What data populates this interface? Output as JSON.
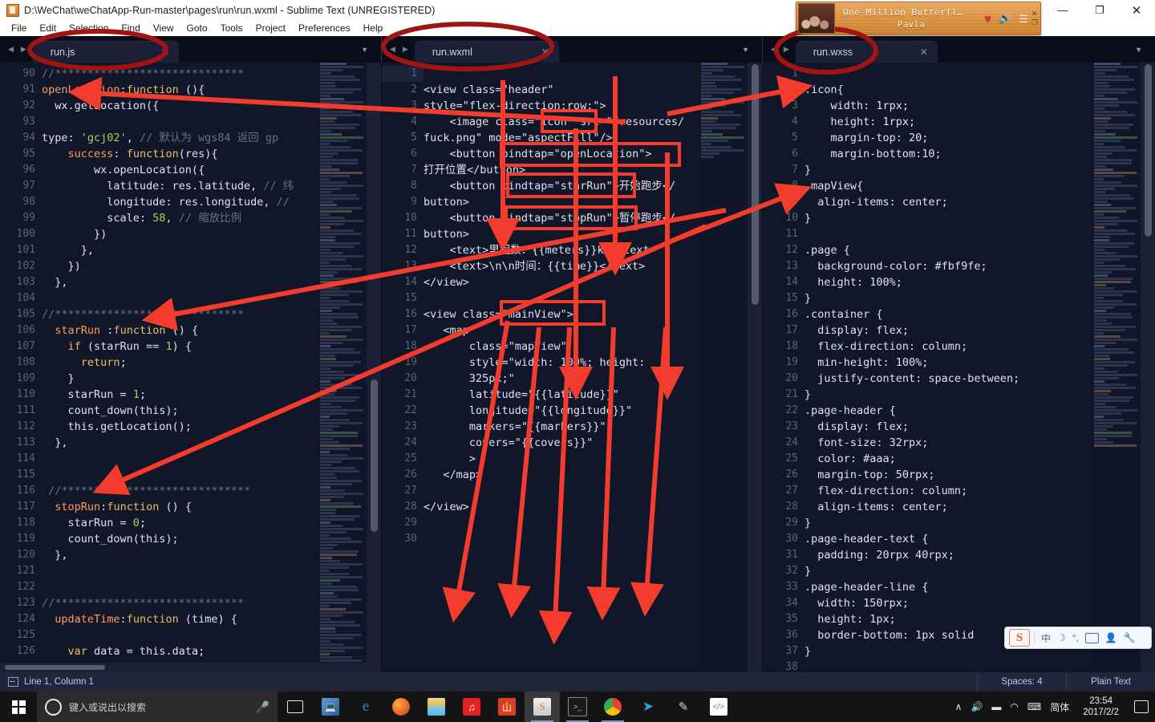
{
  "window": {
    "title": "D:\\WeChat\\weChatApp-Run-master\\pages\\run\\run.wxml - Sublime Text (UNREGISTERED)",
    "minimize": "—",
    "maximize": "❐",
    "close": "✕"
  },
  "menu": [
    "File",
    "Edit",
    "Selection",
    "Find",
    "View",
    "Goto",
    "Tools",
    "Project",
    "Preferences",
    "Help"
  ],
  "music": {
    "title": "One Million Butterfl…",
    "artist": "Pavla",
    "heart": "♥",
    "volume": "🔊",
    "playlist": "☰",
    "close": "✕",
    "restore": "❐"
  },
  "tabs": [
    {
      "name": "run.js",
      "close": "✕",
      "circled": true
    },
    {
      "name": "run.wxml",
      "close": "✕",
      "circled": true
    },
    {
      "name": "run.wxss",
      "close": "✕",
      "circled": true
    }
  ],
  "nav": {
    "prev": "◀",
    "next": "▶",
    "dropdown": "▼"
  },
  "panes": {
    "left": {
      "file": "run.js",
      "first_line": 90,
      "lines": [
        [
          {
            "t": "//*****************************",
            "c": "cm"
          }
        ],
        [
          {
            "t": "openLocation",
            "c": "k"
          },
          {
            "t": ":",
            "c": "pl"
          },
          {
            "t": "function",
            "c": "kw"
          },
          {
            "t": " (){",
            "c": "pl"
          }
        ],
        [
          {
            "t": "  wx.getLocation({",
            "c": "pl"
          }
        ],
        [
          {
            "t": "",
            "c": "pl"
          }
        ],
        [
          {
            "t": "type: ",
            "c": "pl"
          },
          {
            "t": "'gcj02'",
            "c": "str"
          },
          {
            "t": ", ",
            "c": "pl"
          },
          {
            "t": "// 默认为 wgs84 返回 gp",
            "c": "cm"
          }
        ],
        [
          {
            "t": "    ",
            "c": "pl"
          },
          {
            "t": "success",
            "c": "k"
          },
          {
            "t": ": ",
            "c": "pl"
          },
          {
            "t": "function",
            "c": "kw"
          },
          {
            "t": "(res){",
            "c": "pl"
          }
        ],
        [
          {
            "t": "        wx.openLocation({",
            "c": "pl"
          }
        ],
        [
          {
            "t": "          latitude: res.latitude, ",
            "c": "pl"
          },
          {
            "t": "// 纬",
            "c": "cm"
          }
        ],
        [
          {
            "t": "          longitude: res.longitude, ",
            "c": "pl"
          },
          {
            "t": "//",
            "c": "cm"
          }
        ],
        [
          {
            "t": "          scale: ",
            "c": "pl"
          },
          {
            "t": "58",
            "c": "num"
          },
          {
            "t": ", ",
            "c": "pl"
          },
          {
            "t": "// 缩放比例",
            "c": "cm"
          }
        ],
        [
          {
            "t": "        })",
            "c": "pl"
          }
        ],
        [
          {
            "t": "      },",
            "c": "pl"
          }
        ],
        [
          {
            "t": "    })",
            "c": "pl"
          }
        ],
        [
          {
            "t": "  },",
            "c": "pl"
          }
        ],
        [
          {
            "t": "",
            "c": "pl"
          }
        ],
        [
          {
            "t": "//*****************************",
            "c": "cm"
          }
        ],
        [
          {
            "t": "  ",
            "c": "pl"
          },
          {
            "t": "starRun",
            "c": "k"
          },
          {
            "t": " :",
            "c": "pl"
          },
          {
            "t": "function",
            "c": "kw"
          },
          {
            "t": " () {",
            "c": "pl"
          }
        ],
        [
          {
            "t": "    ",
            "c": "pl"
          },
          {
            "t": "if",
            "c": "kw"
          },
          {
            "t": " (starRun == ",
            "c": "pl"
          },
          {
            "t": "1",
            "c": "num"
          },
          {
            "t": ") {",
            "c": "pl"
          }
        ],
        [
          {
            "t": "      ",
            "c": "pl"
          },
          {
            "t": "return",
            "c": "kw"
          },
          {
            "t": ";",
            "c": "pl"
          }
        ],
        [
          {
            "t": "    }",
            "c": "pl"
          }
        ],
        [
          {
            "t": "    starRun = ",
            "c": "pl"
          },
          {
            "t": "1",
            "c": "num"
          },
          {
            "t": ";",
            "c": "pl"
          }
        ],
        [
          {
            "t": "    count_down(this);",
            "c": "pl"
          }
        ],
        [
          {
            "t": "    this.getLocation();",
            "c": "pl"
          }
        ],
        [
          {
            "t": "  },",
            "c": "pl"
          }
        ],
        [
          {
            "t": "",
            "c": "pl"
          }
        ],
        [
          {
            "t": "",
            "c": "pl"
          }
        ],
        [
          {
            "t": " //*****************************",
            "c": "cm"
          }
        ],
        [
          {
            "t": "  ",
            "c": "pl"
          },
          {
            "t": "stopRun",
            "c": "k"
          },
          {
            "t": ":",
            "c": "pl"
          },
          {
            "t": "function",
            "c": "kw"
          },
          {
            "t": " () {",
            "c": "pl"
          }
        ],
        [
          {
            "t": "    starRun = ",
            "c": "pl"
          },
          {
            "t": "0",
            "c": "num"
          },
          {
            "t": ";",
            "c": "pl"
          }
        ],
        [
          {
            "t": "    count_down(this);",
            "c": "pl"
          }
        ],
        [
          {
            "t": "  },",
            "c": "pl"
          }
        ],
        [
          {
            "t": "",
            "c": "pl"
          }
        ],
        [
          {
            "t": "",
            "c": "pl"
          }
        ],
        [
          {
            "t": "//*****************************",
            "c": "cm"
          }
        ],
        [
          {
            "t": "  ",
            "c": "pl"
          },
          {
            "t": "updateTime",
            "c": "k"
          },
          {
            "t": ":",
            "c": "pl"
          },
          {
            "t": "function",
            "c": "kw"
          },
          {
            "t": " (time) {",
            "c": "pl"
          }
        ],
        [
          {
            "t": "",
            "c": "pl"
          }
        ],
        [
          {
            "t": "    ",
            "c": "pl"
          },
          {
            "t": "var",
            "c": "kw"
          },
          {
            "t": " data = this.data;",
            "c": "pl"
          }
        ]
      ]
    },
    "middle": {
      "file": "run.wxml",
      "first_line": 1,
      "lines": [
        [
          {
            "t": "",
            "c": "pl"
          }
        ],
        [
          {
            "t": "<view class=\"header\"",
            "c": "tg"
          }
        ],
        [
          {
            "t": "style=\"flex-direction:row;\">",
            "c": "tg"
          }
        ],
        [
          {
            "t": "    <image class=\"icon\" src=\"/resources/",
            "c": "tg"
          }
        ],
        [
          {
            "t": "fuck.png\" mode=\"aspectFill\"/>",
            "c": "tg"
          }
        ],
        [
          {
            "t": "    <button bindtap=\"openLocation\">",
            "c": "tg"
          }
        ],
        [
          {
            "t": "打开位置</button>",
            "c": "tg"
          }
        ],
        [
          {
            "t": "    <button bindtap=\"starRun\">开始跑步</",
            "c": "tg"
          }
        ],
        [
          {
            "t": "button>",
            "c": "tg"
          }
        ],
        [
          {
            "t": "    <button bindtap=\"stopRun\">暂停跑步</",
            "c": "tg"
          }
        ],
        [
          {
            "t": "button>",
            "c": "tg"
          }
        ],
        [
          {
            "t": "    <text>里程数：{{meters}}km</text>",
            "c": "tg"
          }
        ],
        [
          {
            "t": "    <text>\\n\\n时间：{{time}}</text>",
            "c": "tg"
          }
        ],
        [
          {
            "t": "</view>",
            "c": "tg"
          }
        ],
        [
          {
            "t": "",
            "c": "pl"
          }
        ],
        [
          {
            "t": "<view class=\"mainView\">",
            "c": "tg"
          }
        ],
        [
          {
            "t": "   <map",
            "c": "tg"
          }
        ],
        [
          {
            "t": "       class=\"mapView\"",
            "c": "tg"
          }
        ],
        [
          {
            "t": "       style=\"width: 100%; height:",
            "c": "tg"
          }
        ],
        [
          {
            "t": "       325px;\"",
            "c": "tg"
          }
        ],
        [
          {
            "t": "       latitude=\"{{latitude}}\"",
            "c": "tg"
          }
        ],
        [
          {
            "t": "       longitude=\"{{longitude}}\"",
            "c": "tg"
          }
        ],
        [
          {
            "t": "       markers=\"{{markers}}\"",
            "c": "tg"
          }
        ],
        [
          {
            "t": "       covers=\"{{covers}}\"",
            "c": "tg"
          }
        ],
        [
          {
            "t": "       >",
            "c": "tg"
          }
        ],
        [
          {
            "t": "   </map>",
            "c": "tg"
          }
        ],
        [
          {
            "t": "",
            "c": "pl"
          }
        ],
        [
          {
            "t": "</view>",
            "c": "tg"
          }
        ],
        [
          {
            "t": "",
            "c": "pl"
          }
        ],
        [
          {
            "t": "",
            "c": "pl"
          }
        ]
      ],
      "line_numbers": [
        1,
        2,
        3,
        4,
        5,
        6,
        7,
        8,
        9,
        10,
        11,
        12,
        13,
        14,
        15,
        16,
        17,
        18,
        19,
        20,
        21,
        22,
        23,
        24
      ]
    },
    "right": {
      "file": "run.wxss",
      "first_line": 1,
      "lines": [
        [
          {
            "t": "",
            "c": "pl"
          }
        ],
        [
          {
            "t": ".icon{",
            "c": "cssel"
          }
        ],
        [
          {
            "t": "    width: 1rpx;",
            "c": "cssprop"
          }
        ],
        [
          {
            "t": "    height: 1rpx;",
            "c": "cssprop"
          }
        ],
        [
          {
            "t": "    margin-top: 20;",
            "c": "cssprop"
          }
        ],
        [
          {
            "t": "    margin-bottom:10;",
            "c": "cssprop"
          }
        ],
        [
          {
            "t": "}",
            "c": "cssel"
          }
        ],
        [
          {
            "t": ".mapView{",
            "c": "cssel"
          }
        ],
        [
          {
            "t": "  align-items: center;",
            "c": "cssprop"
          }
        ],
        [
          {
            "t": "}",
            "c": "cssel"
          }
        ],
        [
          {
            "t": "",
            "c": "pl"
          }
        ],
        [
          {
            "t": ".page {",
            "c": "cssel"
          }
        ],
        [
          {
            "t": "  background-color: #fbf9fe;",
            "c": "cssprop"
          }
        ],
        [
          {
            "t": "  height: 100%;",
            "c": "cssprop"
          }
        ],
        [
          {
            "t": "}",
            "c": "cssel"
          }
        ],
        [
          {
            "t": ".container {",
            "c": "cssel"
          }
        ],
        [
          {
            "t": "  display: flex;",
            "c": "cssprop"
          }
        ],
        [
          {
            "t": "  flex-direction: column;",
            "c": "cssprop"
          }
        ],
        [
          {
            "t": "  min-height: 100%;",
            "c": "cssprop"
          }
        ],
        [
          {
            "t": "  justify-content: space-between;",
            "c": "cssprop"
          }
        ],
        [
          {
            "t": "}",
            "c": "cssel"
          }
        ],
        [
          {
            "t": ".page-header {",
            "c": "cssel"
          }
        ],
        [
          {
            "t": "  display: flex;",
            "c": "cssprop"
          }
        ],
        [
          {
            "t": "  font-size: 32rpx;",
            "c": "cssprop"
          }
        ],
        [
          {
            "t": "  color: #aaa;",
            "c": "cssprop"
          }
        ],
        [
          {
            "t": "  margin-top: 50rpx;",
            "c": "cssprop"
          }
        ],
        [
          {
            "t": "  flex-direction: column;",
            "c": "cssprop"
          }
        ],
        [
          {
            "t": "  align-items: center;",
            "c": "cssprop"
          }
        ],
        [
          {
            "t": "}",
            "c": "cssel"
          }
        ],
        [
          {
            "t": ".page-header-text {",
            "c": "cssel"
          }
        ],
        [
          {
            "t": "  padding: 20rpx 40rpx;",
            "c": "cssprop"
          }
        ],
        [
          {
            "t": "}",
            "c": "cssel"
          }
        ],
        [
          {
            "t": ".page-header-line {",
            "c": "cssel"
          }
        ],
        [
          {
            "t": "  width: 150rpx;",
            "c": "cssprop"
          }
        ],
        [
          {
            "t": "  height: 1px;",
            "c": "cssprop"
          }
        ],
        [
          {
            "t": "  border-bottom: 1px solid",
            "c": "cssprop"
          }
        ],
        [
          {
            "t": "}",
            "c": "cssel"
          }
        ],
        [
          {
            "t": "",
            "c": "pl"
          }
        ]
      ]
    }
  },
  "statusbar": {
    "position": "Line 1, Column 1",
    "spaces": "Spaces: 4",
    "syntax": "Plain Text"
  },
  "taskbar": {
    "search_placeholder": "键入或说出以搜索",
    "mic": "🎤",
    "time": "23:54",
    "date": "2017/2/2",
    "ime_lang": "简体",
    "icons": [
      {
        "name": "task-view-icon",
        "glyph": "▢"
      },
      {
        "name": "network-computer-icon",
        "glyph": "🖥"
      },
      {
        "name": "edge-icon",
        "glyph": "e"
      },
      {
        "name": "firefox-icon",
        "glyph": "●"
      },
      {
        "name": "file-explorer-icon",
        "glyph": "📁"
      },
      {
        "name": "netease-music-icon",
        "glyph": "♫"
      },
      {
        "name": "xunlei-icon",
        "glyph": "山"
      },
      {
        "name": "sublime-text-icon",
        "glyph": "S"
      },
      {
        "name": "terminal-icon",
        "glyph": "■"
      },
      {
        "name": "chrome-icon",
        "glyph": "●"
      },
      {
        "name": "telegram-icon",
        "glyph": "➤"
      },
      {
        "name": "wechat-devtool-icon",
        "glyph": "✎"
      },
      {
        "name": "code-editor-icon",
        "glyph": "</>"
      }
    ],
    "tray": [
      {
        "name": "show-hidden-icons",
        "glyph": "∧"
      },
      {
        "name": "volume-icon",
        "glyph": "🔊"
      },
      {
        "name": "battery-icon",
        "glyph": "▬"
      },
      {
        "name": "wifi-icon",
        "glyph": "◠"
      },
      {
        "name": "keyboard-icon",
        "glyph": "⌨"
      }
    ]
  },
  "sogou": {
    "logo": "S",
    "mode": "中",
    "moon": "☽",
    "punct": "°,",
    "keyboard": "⌨",
    "user": "👤",
    "tools": "🔧"
  },
  "annotations": {
    "highlight_color": "#e83a2e",
    "circle_color": "#a01818",
    "boxes": [
      {
        "label": "icon-class-box"
      },
      {
        "label": "openLocation-bindtap-box"
      },
      {
        "label": "starRun-bindtap-box"
      },
      {
        "label": "stopRun-bindtap-box"
      },
      {
        "label": "mainView-class-box"
      }
    ]
  }
}
